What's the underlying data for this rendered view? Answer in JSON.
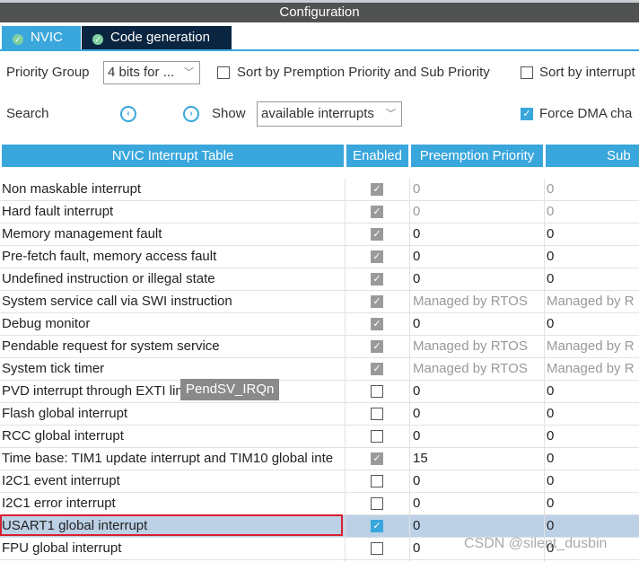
{
  "window": {
    "title": "Configuration"
  },
  "tabs": [
    {
      "label": "NVIC",
      "active": false
    },
    {
      "label": "Code generation",
      "active": true
    }
  ],
  "toolbar": {
    "priority_group_label": "Priority Group",
    "priority_group_value": "4 bits for ...",
    "sort_premption_label": "Sort by Premption Priority and Sub Priority",
    "sort_premption_checked": false,
    "sort_interrupt_label": "Sort by interrupt",
    "sort_interrupt_checked": false,
    "search_label": "Search",
    "show_label": "Show",
    "show_value": "available interrupts",
    "force_dma_label": "Force DMA cha",
    "force_dma_checked": true
  },
  "table": {
    "headers": [
      "NVIC Interrupt Table",
      "Enabled",
      "Preemption Priority",
      "Sub"
    ],
    "rows": [
      {
        "name": "Non maskable interrupt",
        "enabled": "locked",
        "preempt": "0",
        "sub": "0",
        "dim": true
      },
      {
        "name": "Hard fault interrupt",
        "enabled": "locked",
        "preempt": "0",
        "sub": "0",
        "dim": true
      },
      {
        "name": "Memory management fault",
        "enabled": "locked",
        "preempt": "0",
        "sub": "0",
        "dim": false
      },
      {
        "name": "Pre-fetch fault, memory access fault",
        "enabled": "locked",
        "preempt": "0",
        "sub": "0",
        "dim": false
      },
      {
        "name": "Undefined instruction or illegal state",
        "enabled": "locked",
        "preempt": "0",
        "sub": "0",
        "dim": false
      },
      {
        "name": "System service call via SWI instruction",
        "enabled": "locked",
        "preempt": "Managed by RTOS",
        "sub": "Managed by R",
        "dim": true
      },
      {
        "name": "Debug monitor",
        "enabled": "locked",
        "preempt": "0",
        "sub": "0",
        "dim": false
      },
      {
        "name": "Pendable request for system service",
        "enabled": "locked",
        "preempt": "Managed by RTOS",
        "sub": "Managed by R",
        "dim": true
      },
      {
        "name": "System tick timer",
        "enabled": "locked",
        "preempt": "Managed by RTOS",
        "sub": "Managed by R",
        "dim": true
      },
      {
        "name": "PVD interrupt through EXTI line",
        "enabled": "off",
        "preempt": "0",
        "sub": "0",
        "dim": false
      },
      {
        "name": "Flash global interrupt",
        "enabled": "off",
        "preempt": "0",
        "sub": "0",
        "dim": false
      },
      {
        "name": "RCC global interrupt",
        "enabled": "off",
        "preempt": "0",
        "sub": "0",
        "dim": false
      },
      {
        "name": "Time base: TIM1 update interrupt and TIM10 global inte",
        "enabled": "locked",
        "preempt": "15",
        "sub": "0",
        "dim": false
      },
      {
        "name": "I2C1 event interrupt",
        "enabled": "off",
        "preempt": "0",
        "sub": "0",
        "dim": false
      },
      {
        "name": "I2C1 error interrupt",
        "enabled": "off",
        "preempt": "0",
        "sub": "0",
        "dim": false
      },
      {
        "name": "USART1 global interrupt",
        "enabled": "on",
        "preempt": "0",
        "sub": "0",
        "dim": false,
        "selected": true
      },
      {
        "name": "FPU global interrupt",
        "enabled": "off",
        "preempt": "0",
        "sub": "0",
        "dim": false
      }
    ]
  },
  "tooltip": "PendSV_IRQn",
  "watermark": "CSDN @silent_dusbin",
  "colors": {
    "accent": "#39a6dc",
    "titlebar": "#505251",
    "active_tab": "#0a2540",
    "selected_row": "#bcd1e6",
    "highlight_box": "#d8202f"
  }
}
